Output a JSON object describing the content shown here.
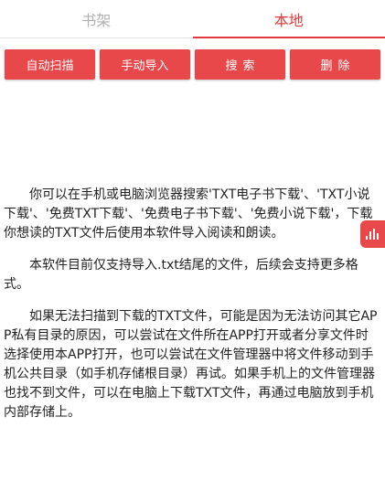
{
  "tabs": [
    {
      "label": "书架",
      "active": false
    },
    {
      "label": "本地",
      "active": true
    }
  ],
  "toolbar": {
    "auto_scan": "自动扫描",
    "manual_import": "手动导入",
    "search": "搜索",
    "delete": "删除"
  },
  "content": {
    "p1": "你可以在手机或电脑浏览器搜索'TXT电子书下载'、'TXT小说下载'、'免费TXT下载'、'免费电子书下载'、'免费小说下载'，下载你想读的TXT文件后使用本软件导入阅读和朗读。",
    "p2": "本软件目前仅支持导入.txt结尾的文件，后续会支持更多格式。",
    "p3": "如果无法扫描到下载的TXT文件，可能是因为无法访问其它APP私有目录的原因，可以尝试在文件所在APP打开或者分享文件时选择使用本APP打开，也可以尝试在文件管理器中将文件移动到手机公共目录（如手机存储根目录）再试。如果手机上的文件管理器也找不到文件，可以在电脑上下载TXT文件，再通过电脑放到手机内部存储上。"
  },
  "floating_widget": {
    "icon": "equalizer-icon",
    "color": "#e8484a"
  },
  "colors": {
    "accent": "#e03a3e",
    "button": "#e8484a",
    "inactive_tab": "#b0b0b0"
  }
}
